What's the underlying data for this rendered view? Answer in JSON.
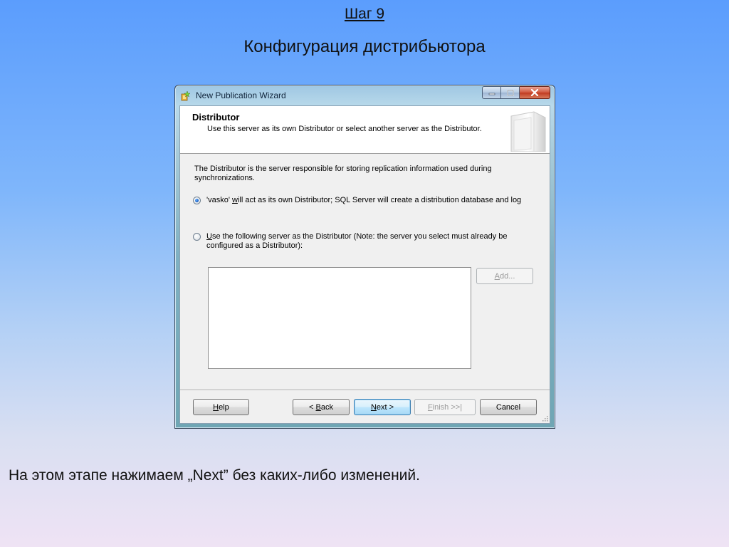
{
  "slide": {
    "step": "Шаг 9",
    "title": "Конфигурация дистрибьютора",
    "caption": "На этом этапе нажимаем „Next” без каких-либо изменений."
  },
  "window": {
    "title": "New Publication Wizard",
    "controls": {
      "minimize": "minimize",
      "maximize": "maximize",
      "close": "close"
    }
  },
  "header": {
    "title": "Distributor",
    "subtitle": "Use this server as its own Distributor or select another server as the Distributor."
  },
  "content": {
    "intro": "The Distributor is the server responsible for storing replication information used during synchronizations.",
    "option1": {
      "before": "'vasko' ",
      "mnemonic": "w",
      "after": "ill act as its own Distributor; SQL Server will create a distribution database and log",
      "selected": true
    },
    "option2": {
      "before": "",
      "mnemonic": "U",
      "after": "se the following server as the Distributor (Note: the server you select must already be configured as a Distributor):",
      "selected": false
    },
    "server_list": [],
    "add_button": {
      "mnemonic": "A",
      "rest": "dd...",
      "enabled": false
    }
  },
  "footer": {
    "help": {
      "mnemonic": "H",
      "rest": "elp"
    },
    "back": {
      "prefix": "< ",
      "mnemonic": "B",
      "rest": "ack"
    },
    "next": {
      "mnemonic": "N",
      "rest": "ext >"
    },
    "finish": {
      "mnemonic": "F",
      "rest": "inish >>|",
      "enabled": false
    },
    "cancel": {
      "label": "Cancel"
    }
  },
  "colors": {
    "accent": "#3c7fb1",
    "radio_selected": "#1a63c9",
    "close_button": "#c0391f"
  }
}
